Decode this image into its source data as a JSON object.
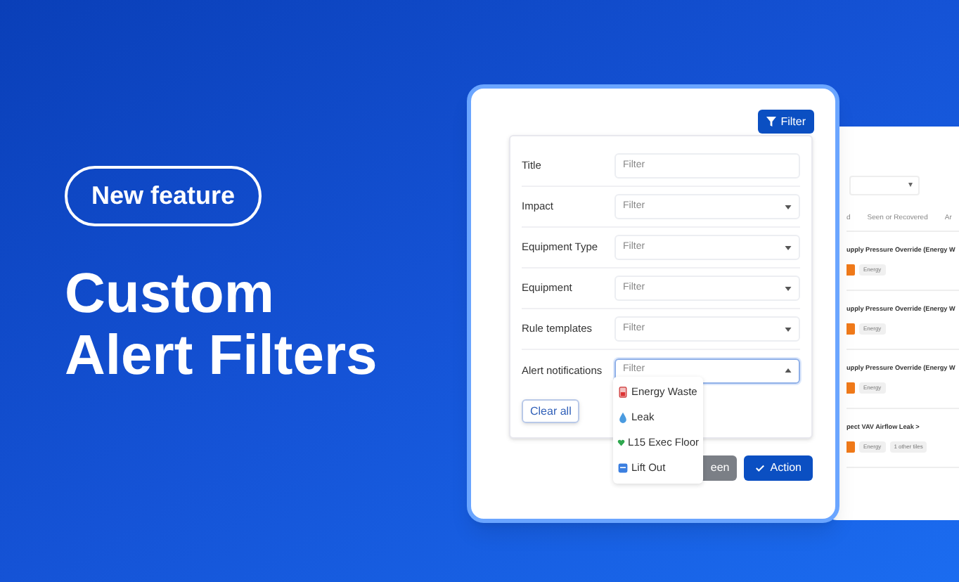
{
  "badge": "New feature",
  "headline": [
    "Custom",
    "Alert Filters"
  ],
  "background_table": {
    "dropdown_caret": "▾",
    "columns": [
      "d",
      "Seen or Recovered",
      "Ar"
    ],
    "rows": [
      {
        "title": "upply Pressure Override (Energy W",
        "tags": [
          "Energy"
        ]
      },
      {
        "title": "upply Pressure Override (Energy W",
        "tags": [
          "Energy"
        ]
      },
      {
        "title": "upply Pressure Override (Energy W",
        "tags": [
          "Energy"
        ]
      },
      {
        "title": "pect VAV Airflow Leak >",
        "tags": [
          "Energy",
          "1 other tiles"
        ]
      }
    ]
  },
  "filter_button": {
    "label": "Filter"
  },
  "filters": [
    {
      "label": "Title",
      "kind": "text",
      "placeholder": "Filter",
      "expanded": false
    },
    {
      "label": "Impact",
      "kind": "select",
      "placeholder": "Filter",
      "expanded": false
    },
    {
      "label": "Equipment Type",
      "kind": "select",
      "placeholder": "Filter",
      "expanded": false
    },
    {
      "label": "Equipment",
      "kind": "select",
      "placeholder": "Filter",
      "expanded": false
    },
    {
      "label": "Rule templates",
      "kind": "select",
      "placeholder": "Filter",
      "expanded": false
    },
    {
      "label": "Alert notifications",
      "kind": "select",
      "placeholder": "Filter",
      "expanded": true
    }
  ],
  "clear_button": "Clear all",
  "dropdown_options": [
    {
      "label": "Energy Waste"
    },
    {
      "label": "Leak"
    },
    {
      "label": "L15 Exec Floor"
    },
    {
      "label": "Lift Out"
    }
  ],
  "footer_buttons": [
    {
      "label": "een",
      "kind": "secondary"
    },
    {
      "label": "Action",
      "kind": "primary"
    }
  ]
}
